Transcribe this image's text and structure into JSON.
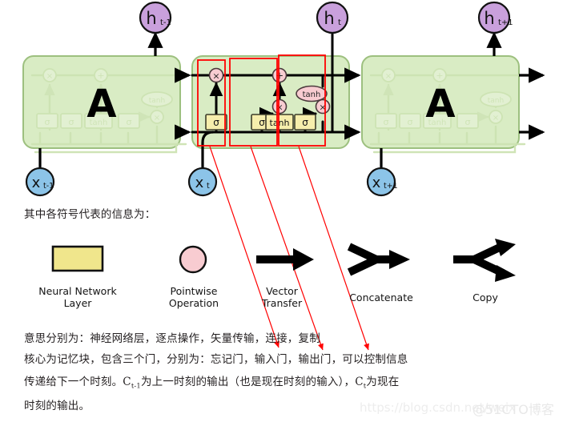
{
  "diagram": {
    "title_alt": "LSTM unrolled chain diagram",
    "cells": [
      {
        "id": "cell-prev",
        "label": "A",
        "input_label": "x",
        "input_sub": "t-1",
        "output_label": "h",
        "output_sub": "t-1"
      },
      {
        "id": "cell-curr",
        "label": "",
        "input_label": "x",
        "input_sub": "t",
        "output_label": "h",
        "output_sub": "t"
      },
      {
        "id": "cell-next",
        "label": "A",
        "input_label": "x",
        "input_sub": "t+1",
        "output_label": "h",
        "output_sub": "t+1"
      }
    ],
    "gate_labels": {
      "forget_sigma": "σ",
      "input_sigma": "σ",
      "candidate_tanh": "tanh",
      "output_sigma": "σ",
      "cell_tanh": "tanh",
      "multiply": "×",
      "add": "+"
    },
    "highlight_boxes": [
      {
        "name": "forget-gate-box"
      },
      {
        "name": "input-gate-box"
      },
      {
        "name": "output-gate-box"
      }
    ],
    "colors": {
      "cell_fill": "#d9ecc4",
      "cell_stroke": "#9cbf7e",
      "gate_fill": "#f6eeac",
      "gate_stroke": "#3d3d2a",
      "pointwise_fill": "#f8ccd1",
      "pointwise_stroke": "#4a3a3c",
      "hidden_fill": "#c9a0dc",
      "input_fill": "#8cc4e8",
      "node_stroke": "#111111",
      "highlight": "#ff0000",
      "line": "#000000"
    }
  },
  "intro": {
    "line": "其中各符号代表的信息为："
  },
  "legend": {
    "items": [
      {
        "name": "neural-network-layer",
        "icon": "yellow-rectangle-icon",
        "label": "Neural Network\nLayer"
      },
      {
        "name": "pointwise-operation",
        "icon": "pink-circle-icon",
        "label": "Pointwise\nOperation"
      },
      {
        "name": "vector-transfer",
        "icon": "arrow-right-icon",
        "label": "Vector\nTransfer"
      },
      {
        "name": "concatenate",
        "icon": "merge-arrow-icon",
        "label": "Concatenate"
      },
      {
        "name": "copy",
        "icon": "fork-arrow-icon",
        "label": "Copy"
      }
    ]
  },
  "notes": {
    "line1": "意思分别为：神经网络层，逐点操作，矢量传输，连接，复制",
    "line2": "核心为记忆块，包含三个门，分别为：忘记门，输入门，输出门，可以控制信息",
    "line3_a": "传递给下一个时刻。C",
    "line3_sub1": "t-1",
    "line3_b": "为上一时刻的输出（也是现在时刻的输入），C",
    "line3_sub2": "t",
    "line3_c": "为现在",
    "line4": "时刻的输出。"
  },
  "watermark": {
    "url": "https://blog.csdn.net/weix",
    "brand": "@51CTO博客"
  }
}
